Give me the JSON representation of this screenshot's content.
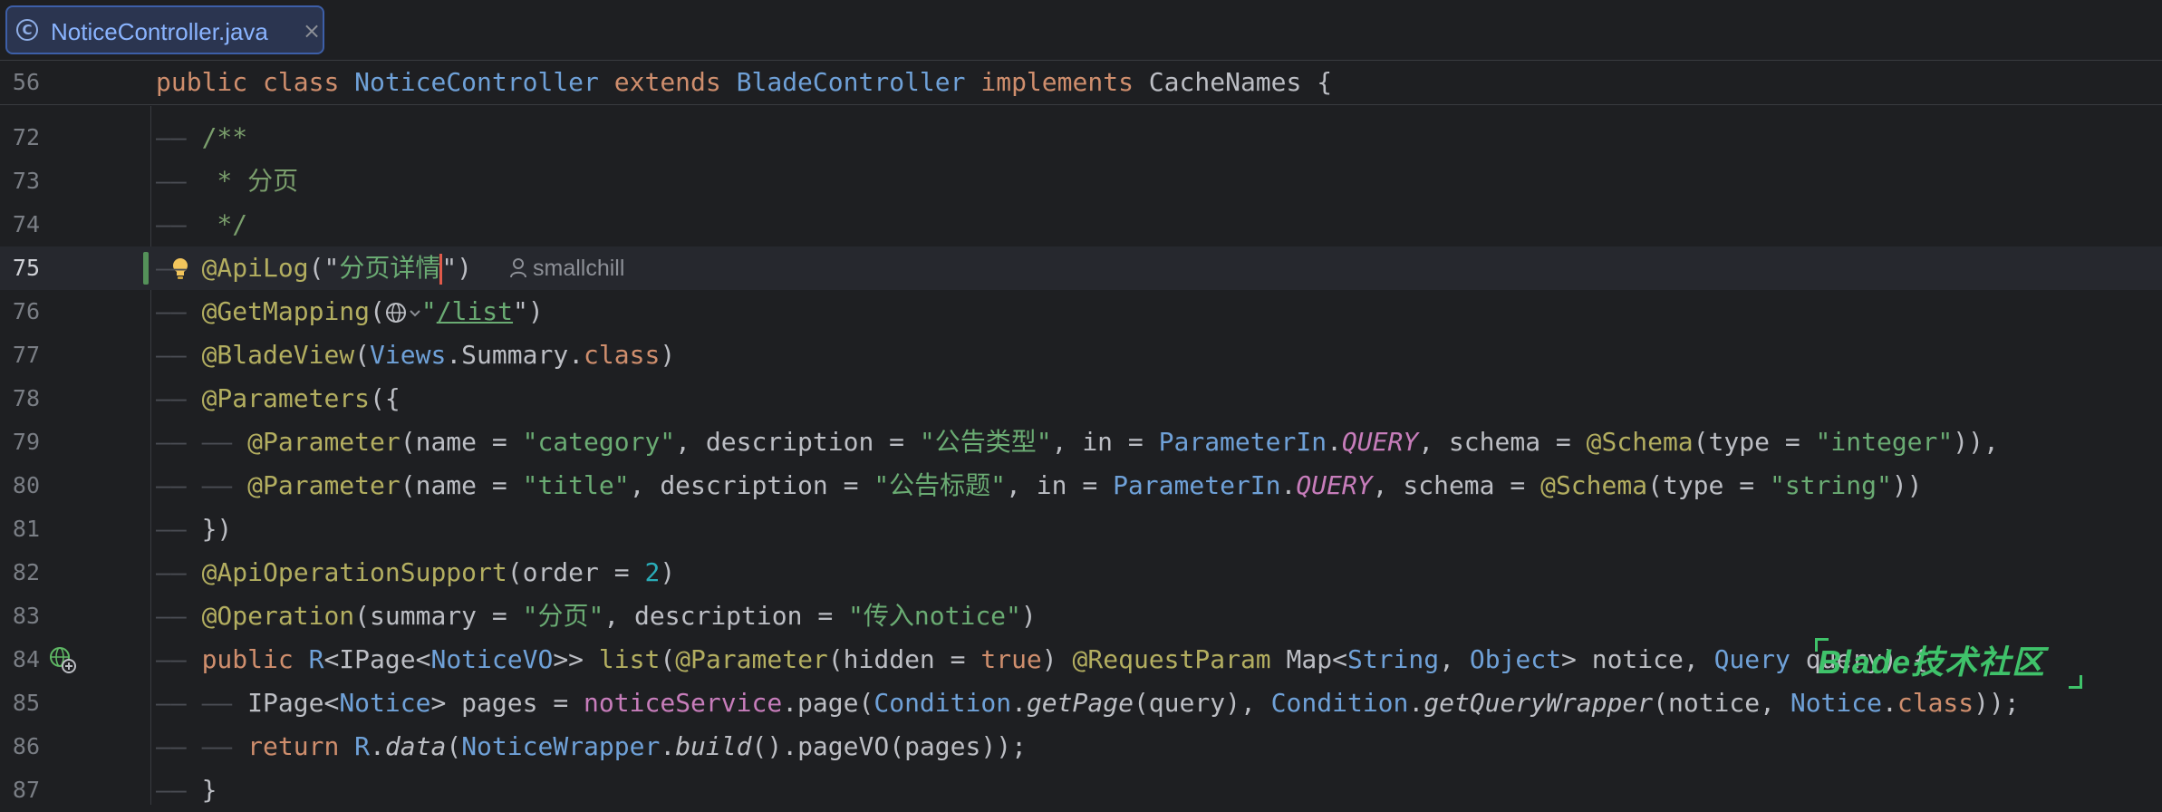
{
  "tab": {
    "file_name": "NoticeController.java",
    "close_glyph": "×",
    "class_icon_letter": "C"
  },
  "sticky": {
    "line_number": "56",
    "tokens": {
      "kw1": "public",
      "kw2": "class",
      "name": "NoticeController",
      "kw3": "extends",
      "parent": "BladeController",
      "kw4": "implements",
      "iface": "CacheNames",
      "brace": "{"
    }
  },
  "lines": [
    {
      "n": "72",
      "text": "/**"
    },
    {
      "n": "73",
      "text": " * 分页"
    },
    {
      "n": "74",
      "text": " */"
    },
    {
      "n": "75",
      "an": "@ApiLog",
      "open": "(\"",
      "str_before": "分页详情",
      "str_after": "",
      "close": "\")",
      "author": "smallchill"
    },
    {
      "n": "76",
      "an": "@GetMapping",
      "open": "(",
      "url": "/list",
      "close": "\")"
    },
    {
      "n": "77",
      "an": "@BladeView",
      "open": "(",
      "t1": "Views",
      "dot1": ".",
      "t2": "Summary",
      "dot2": ".",
      "kw": "class",
      "close": ")"
    },
    {
      "n": "78",
      "an": "@Parameters",
      "open": "({"
    },
    {
      "n": "79",
      "an": "@Parameter",
      "p1": "(name = ",
      "s1": "\"category\"",
      "p2": ", description = ",
      "s2": "\"公告类型\"",
      "p3": ", in = ",
      "t1": "ParameterIn",
      "dot": ".",
      "c1": "QUERY",
      "p4": ", schema = ",
      "an2": "@Schema",
      "p5": "(type = ",
      "s3": "\"integer\"",
      "p6": ")),"
    },
    {
      "n": "80",
      "an": "@Parameter",
      "p1": "(name = ",
      "s1": "\"title\"",
      "p2": ", description = ",
      "s2": "\"公告标题\"",
      "p3": ", in = ",
      "t1": "ParameterIn",
      "dot": ".",
      "c1": "QUERY",
      "p4": ", schema = ",
      "an2": "@Schema",
      "p5": "(type = ",
      "s3": "\"string\"",
      "p6": "))"
    },
    {
      "n": "81",
      "text": "})"
    },
    {
      "n": "82",
      "an": "@ApiOperationSupport",
      "p1": "(order = ",
      "num": "2",
      "p2": ")"
    },
    {
      "n": "83",
      "an": "@Operation",
      "p1": "(summary = ",
      "s1": "\"分页\"",
      "p2": ", description = ",
      "s2": "\"传入notice\"",
      "p3": ")"
    },
    {
      "n": "84",
      "kw": "public",
      "t1": "R",
      "p1": "<IPage<",
      "t2": "NoticeVO",
      "p2": ">> ",
      "fn": "list",
      "p3": "(",
      "an": "@Parameter",
      "p4": "(hidden = ",
      "kw2": "true",
      "p5": ") ",
      "an2": "@RequestParam",
      "p6": " Map<",
      "t3": "String",
      "p7": ", ",
      "t4": "Object",
      "p8": "> notice, ",
      "t5": "Query",
      "p9": " query) {"
    },
    {
      "n": "85",
      "p1": "IPage<",
      "t1": "Notice",
      "p2": "> pages = ",
      "fld": "noticeService",
      "p3": ".page(",
      "t2": "Condition",
      "dot1": ".",
      "m1": "getPage",
      "p4": "(query), ",
      "t3": "Condition",
      "dot2": ".",
      "m2": "getQueryWrapper",
      "p5": "(notice, ",
      "t4": "Notice",
      "dot3": ".",
      "kw": "class",
      "p6": "));"
    },
    {
      "n": "86",
      "kw": "return",
      "p1": " ",
      "t1": "R",
      "dot1": ".",
      "m1": "data",
      "p2": "(",
      "t2": "NoticeWrapper",
      "dot2": ".",
      "m2": "build",
      "p3": "().pageVO(pages));"
    },
    {
      "n": "87",
      "text": "}"
    }
  ],
  "guides": {
    "l1": "—— ",
    "l2": "—— —— "
  },
  "watermark": {
    "text": "Blade技术社区"
  },
  "colors": {
    "background": "#1e1f22",
    "keyword": "#cf8e6d",
    "type": "#6fa1d8",
    "annotation": "#b3ae60",
    "string": "#6aab73",
    "constant": "#c77dbb",
    "number": "#2aacb8",
    "function": "#56a8f5",
    "tab_accent": "#3d5fa8",
    "vcs_change": "#549159",
    "caret": "#e05a4a",
    "watermark": "#3fc26a"
  },
  "icons": [
    "class-icon",
    "close-icon",
    "lightbulb-icon",
    "globe-icon",
    "chevron-down-icon",
    "user-icon",
    "run-endpoint-icon"
  ]
}
